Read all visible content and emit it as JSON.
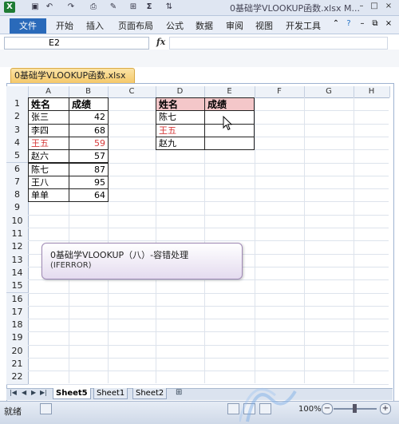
{
  "window": {
    "title": "0基础学VLOOKUP函数.xlsx M...",
    "minimize": "–",
    "restore": "□",
    "close": "×"
  },
  "quick_access": [
    "excel-icon",
    "save-icon",
    "undo-icon",
    "redo-icon",
    "print-preview-icon",
    "format-painter-icon",
    "borders-icon",
    "autosum-icon",
    "sort-icon"
  ],
  "quick_access_glyphs": {
    "autosum": "Σ"
  },
  "ribbon": {
    "file": "文件",
    "tabs": [
      "开始",
      "插入",
      "页面布局",
      "公式",
      "数据",
      "审阅",
      "视图",
      "开发工具"
    ]
  },
  "formula_bar": {
    "name_box": "E2",
    "fx": "fx",
    "formula": ""
  },
  "workbook_tab": "0基础学VLOOKUP函数.xlsx",
  "columns": [
    "A",
    "B",
    "C",
    "D",
    "E",
    "F",
    "G",
    "H"
  ],
  "rows": [
    "1",
    "2",
    "3",
    "4",
    "5",
    "6",
    "7",
    "8",
    "9",
    "10",
    "11",
    "12",
    "13",
    "14",
    "15",
    "16",
    "17",
    "18",
    "19",
    "20",
    "21",
    "22"
  ],
  "table1": {
    "header": [
      "姓名",
      "成绩"
    ],
    "rows": [
      {
        "name": "张三",
        "score": "42"
      },
      {
        "name": "李四",
        "score": "68"
      },
      {
        "name": "王五",
        "score": "59"
      },
      {
        "name": "赵六",
        "score": "57"
      },
      {
        "name": "陈七",
        "score": "87"
      },
      {
        "name": "王八",
        "score": "95"
      },
      {
        "name": "单单",
        "score": "64"
      }
    ]
  },
  "table2": {
    "header": [
      "姓名",
      "成绩"
    ],
    "rows": [
      {
        "name": "陈七",
        "score": ""
      },
      {
        "name": "王五",
        "score": ""
      },
      {
        "name": "赵九",
        "score": ""
      }
    ]
  },
  "callout": {
    "line1": "0基础学VLOOKUP（八）-容错处理",
    "line2": "(IFERROR)"
  },
  "sheets": [
    "Sheet5",
    "Sheet1",
    "Sheet2"
  ],
  "status": {
    "ready": "就绪",
    "zoom": "100%"
  },
  "colors": {
    "file_tab": "#2a6aba",
    "highlight_header": "#f4c7c9",
    "red_text": "#d63a3a"
  }
}
